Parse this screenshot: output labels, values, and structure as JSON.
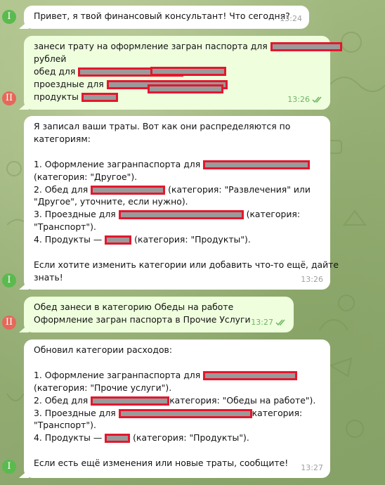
{
  "chat": {
    "messages": [
      {
        "sender": "bot",
        "avatar_letter": "I",
        "lines": [
          "Привет, я твой финансовый консультант! Что сегодня?"
        ],
        "time": "13:24"
      },
      {
        "sender": "user",
        "avatar_letter": "II",
        "lines": [
          "занеси трату на оформление загран паспорта для",
          "рублей",
          "обед для",
          "проездные для",
          "продукты"
        ],
        "time": "13:26",
        "read": true
      },
      {
        "sender": "bot",
        "avatar_letter": "I",
        "lines": [
          "Я записал ваши траты. Вот как они распределяются по",
          "категориям:",
          "",
          "1. Оформление загранпаспорта для",
          "(категория: \"Другое\").",
          "2. Обед для",
          "(категория: \"Развлечения\" или",
          "\"Другое\", уточните, если нужно).",
          "3. Проездные для",
          "(категория:",
          "\"Транспорт\").",
          "4. Продукты —",
          "(категория: \"Продукты\").",
          "",
          "Если хотите изменить категории или добавить что-то ещё, дайте",
          "знать!"
        ],
        "time": "13:26"
      },
      {
        "sender": "user",
        "avatar_letter": "II",
        "lines": [
          "Обед занеси в категорию Обеды на работе",
          "Оформление загран паспорта в Прочие Услуги"
        ],
        "time": "13:27",
        "read": true
      },
      {
        "sender": "bot",
        "avatar_letter": "I",
        "lines": [
          "Обновил категории расходов:",
          "",
          "1. Оформление загранпаспорта для",
          "(категория: \"Прочие услуги\").",
          "2. Обед для",
          "категория: \"Обеды на работе\").",
          "3. Проездные для",
          "категория:",
          "\"Транспорт\").",
          "4. Продукты —",
          "(категория: \"Продукты\").",
          "",
          "Если есть ещё изменения или новые траты, сообщите!"
        ],
        "time": "13:27"
      }
    ]
  },
  "colors": {
    "background": "#95ae74",
    "incoming_bubble": "#ffffff",
    "outgoing_bubble": "#efffde",
    "redaction_border": "#e3182d",
    "read_checks": "#6cb560",
    "avatar_bot": "#5aba4e",
    "avatar_user": "#e5685a"
  },
  "icons": {
    "read_receipt": "double-check-icon"
  }
}
